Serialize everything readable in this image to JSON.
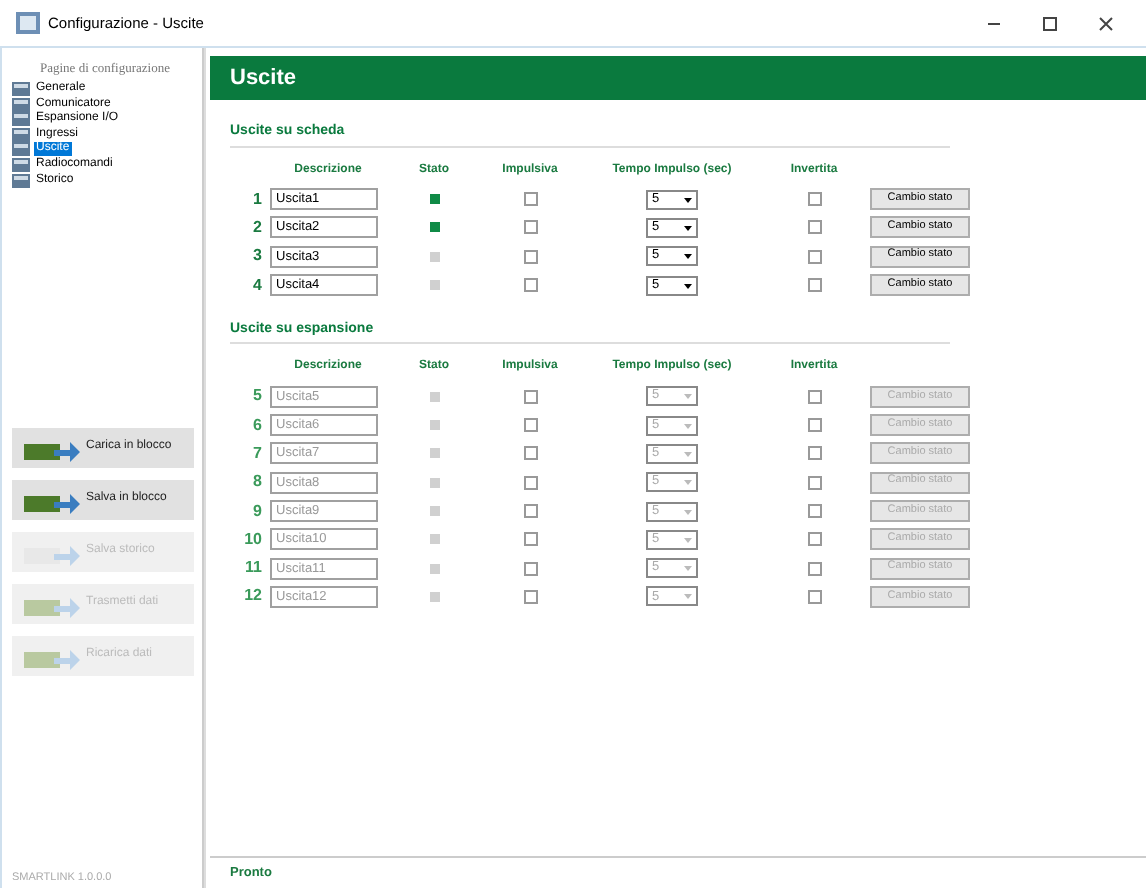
{
  "window": {
    "title": "Configurazione - Uscite"
  },
  "sidebar": {
    "heading": "Pagine di configurazione",
    "items": [
      {
        "label": "Generale",
        "selected": false
      },
      {
        "label": "Comunicatore",
        "selected": false
      },
      {
        "label": "Espansione I/O",
        "selected": false
      },
      {
        "label": "Ingressi",
        "selected": false
      },
      {
        "label": "Uscite",
        "selected": true
      },
      {
        "label": "Radiocomandi",
        "selected": false
      },
      {
        "label": "Storico",
        "selected": false
      }
    ],
    "actions": [
      {
        "label": "Carica in blocco",
        "disabled": false
      },
      {
        "label": "Salva in blocco",
        "disabled": false
      },
      {
        "label": "Salva storico",
        "disabled": true
      },
      {
        "label": "Trasmetti dati",
        "disabled": true
      },
      {
        "label": "Ricarica dati",
        "disabled": true
      }
    ],
    "footer": "SMARTLINK 1.0.0.0"
  },
  "page": {
    "title": "Uscite"
  },
  "sections": [
    {
      "title": "Uscite su scheda",
      "columns": [
        "Descrizione",
        "Stato",
        "Impulsiva",
        "Tempo Impulso (sec)",
        "Invertita"
      ],
      "rows": [
        {
          "number": "1",
          "description": "Uscita1",
          "on": true,
          "impulsive": false,
          "time": "5",
          "inverted": false,
          "button": "Cambio stato",
          "disabled": false
        },
        {
          "number": "2",
          "description": "Uscita2",
          "on": true,
          "impulsive": false,
          "time": "5",
          "inverted": false,
          "button": "Cambio stato",
          "disabled": false
        },
        {
          "number": "3",
          "description": "Uscita3",
          "on": false,
          "impulsive": false,
          "time": "5",
          "inverted": false,
          "button": "Cambio stato",
          "disabled": false
        },
        {
          "number": "4",
          "description": "Uscita4",
          "on": false,
          "impulsive": false,
          "time": "5",
          "inverted": false,
          "button": "Cambio stato",
          "disabled": false
        }
      ]
    },
    {
      "title": "Uscite su espansione",
      "columns": [
        "Descrizione",
        "Stato",
        "Impulsiva",
        "Tempo Impulso (sec)",
        "Invertita"
      ],
      "rows": [
        {
          "number": "5",
          "description": "Uscita5",
          "on": false,
          "impulsive": false,
          "time": "5",
          "inverted": false,
          "button": "Cambio stato",
          "disabled": true
        },
        {
          "number": "6",
          "description": "Uscita6",
          "on": false,
          "impulsive": false,
          "time": "5",
          "inverted": false,
          "button": "Cambio stato",
          "disabled": true
        },
        {
          "number": "7",
          "description": "Uscita7",
          "on": false,
          "impulsive": false,
          "time": "5",
          "inverted": false,
          "button": "Cambio stato",
          "disabled": true
        },
        {
          "number": "8",
          "description": "Uscita8",
          "on": false,
          "impulsive": false,
          "time": "5",
          "inverted": false,
          "button": "Cambio stato",
          "disabled": true
        },
        {
          "number": "9",
          "description": "Uscita9",
          "on": false,
          "impulsive": false,
          "time": "5",
          "inverted": false,
          "button": "Cambio stato",
          "disabled": true
        },
        {
          "number": "10",
          "description": "Uscita10",
          "on": false,
          "impulsive": false,
          "time": "5",
          "inverted": false,
          "button": "Cambio stato",
          "disabled": true
        },
        {
          "number": "11",
          "description": "Uscita11",
          "on": false,
          "impulsive": false,
          "time": "5",
          "inverted": false,
          "button": "Cambio stato",
          "disabled": true
        },
        {
          "number": "12",
          "description": "Uscita12",
          "on": false,
          "impulsive": false,
          "time": "5",
          "inverted": false,
          "button": "Cambio stato",
          "disabled": true
        }
      ]
    }
  ],
  "status_bar": {
    "text": "Pronto"
  }
}
